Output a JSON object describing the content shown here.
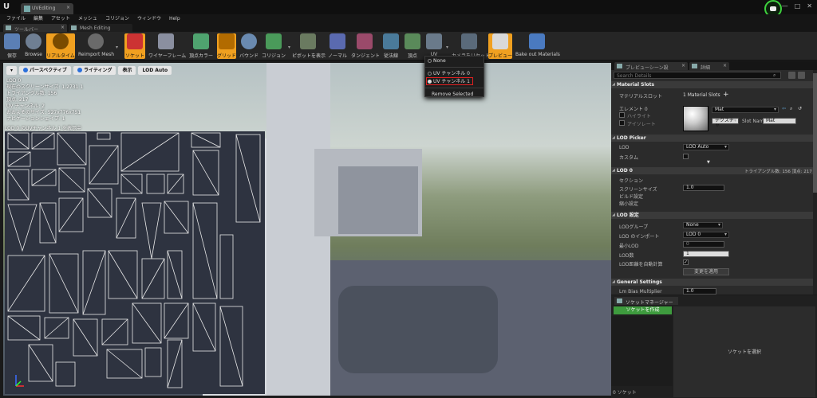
{
  "document_tab": "UVEditing",
  "menu": [
    "ファイル",
    "編集",
    "アセット",
    "メッシュ",
    "コリジョン",
    "ウィンドウ",
    "Help"
  ],
  "panel_tabs": [
    "ツールバー",
    "Mesh Editing"
  ],
  "toolbar": [
    {
      "label": "保存",
      "icon": "save-icon",
      "active": false
    },
    {
      "label": "Browse",
      "icon": "browse-icon",
      "active": false
    },
    {
      "label": "リアルタイム",
      "icon": "realtime-icon",
      "active": true
    },
    {
      "label": "Reimport Mesh",
      "icon": "reimport-icon",
      "active": false
    },
    {
      "label": "ソケット",
      "icon": "socket-icon",
      "active": true
    },
    {
      "label": "ワイヤーフレーム",
      "icon": "wireframe-icon",
      "active": false
    },
    {
      "label": "頂点カラー",
      "icon": "vertex-color-icon",
      "active": false
    },
    {
      "label": "グリッド",
      "icon": "grid-icon",
      "active": true
    },
    {
      "label": "バウンド",
      "icon": "bounds-icon",
      "active": false
    },
    {
      "label": "コリジョン",
      "icon": "collision-icon",
      "active": false
    },
    {
      "label": "ピボットを表示",
      "icon": "pivot-icon",
      "active": false
    },
    {
      "label": "ノーマル",
      "icon": "normal-icon",
      "active": false
    },
    {
      "label": "タンジェント",
      "icon": "tangent-icon",
      "active": false
    },
    {
      "label": "従法線",
      "icon": "binormal-icon",
      "active": false
    },
    {
      "label": "頂点",
      "icon": "vertices-icon",
      "active": false
    },
    {
      "label": "UV",
      "icon": "uv-icon",
      "active": false
    },
    {
      "label": "カメラをリセット",
      "icon": "reset-camera-icon",
      "active": false
    },
    {
      "label": "プレビュー",
      "icon": "preview-icon",
      "active": true
    },
    {
      "label": "Bake out Materials",
      "icon": "bake-materials-icon",
      "active": false
    }
  ],
  "viewport": {
    "buttons": [
      "パースペクティブ",
      "ライティング",
      "表示",
      "LOD Auto"
    ],
    "stats": [
      "LOD 0",
      "現在のスクリーンサイズ: 1.2731 1",
      "トライアングル数: 156",
      "頂点: 217",
      "UV チャンネル: 2",
      "おおよそのサイズ: 527x776x751",
      "ナビゲーションシェイプ: 1"
    ],
    "uv_title": "LOD 0 のUVチャンネル 1 を表示中"
  },
  "uv_dropdown": {
    "items": [
      {
        "label": "None",
        "selected": false
      },
      {
        "label": "UV チャンネル 0",
        "selected": false
      },
      {
        "label": "UV チャンネル 1",
        "selected": true
      }
    ],
    "action": "Remove Selected"
  },
  "right_tabs": [
    "プレビューシーン設",
    "詳細"
  ],
  "details": {
    "search_placeholder": "Search Details",
    "material_slots": {
      "header": "Material Slots",
      "label": "マテリアルスロット",
      "value": "1 Material Slots",
      "element": "エレメント 0",
      "highlight": "ハイライト",
      "isolate": "アイソレート",
      "material": "Mat",
      "texture_button": "テクスチャ",
      "slot_name_label": "Slot Name",
      "slot_name_value": "Mat"
    },
    "lod_picker": {
      "header": "LOD Picker",
      "lod_label": "LOD",
      "lod_value": "LOD Auto",
      "custom_label": "カスタム"
    },
    "lod0": {
      "header": "LOD 0",
      "stats": "トライアングル数: 156 頂点: 217",
      "section_label": "セクション",
      "screen_size_label": "スクリーンサイズ",
      "screen_size_value": "1.0",
      "build_label": "ビルド設定",
      "reduce_label": "縮小設定"
    },
    "lod_settings": {
      "header": "LOD 設定",
      "group_label": "LODグループ",
      "group_value": "None",
      "import_label": "LOD のインポート",
      "import_value": "LOD 0",
      "min_lod_label": "最小LOD",
      "min_lod_value": "0",
      "lod_count_label": "LOD数",
      "lod_count_value": "1",
      "auto_compute_label": "LOD距離を自動計算",
      "apply_button": "変更を適用"
    },
    "general": {
      "header": "General Settings",
      "lm_label": "Lm Bias Multiplier",
      "lm_value": "1.0"
    }
  },
  "socket_manager": {
    "tab": "ソケットマネージャー",
    "create_button": "ソケットを作成",
    "placeholder": "ソケットを選択",
    "count": "0 ソケット"
  }
}
